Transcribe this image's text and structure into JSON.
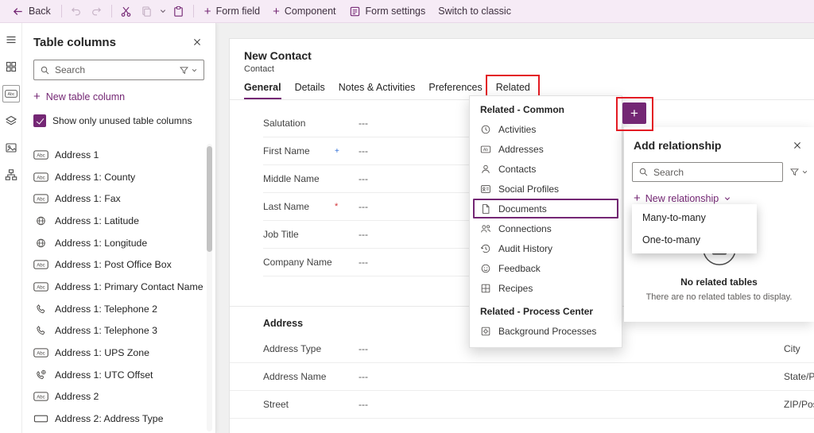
{
  "colors": {
    "accent": "#742774",
    "annotation": "#e31b23",
    "required": "#d13438",
    "recommended": "#2b6bd6"
  },
  "toolbar": {
    "back_label": "Back",
    "form_field_label": "Form field",
    "component_label": "Component",
    "form_settings_label": "Form settings",
    "switch_classic_label": "Switch to classic"
  },
  "left_panel": {
    "title": "Table columns",
    "search_placeholder": "Search",
    "new_column_label": "New table column",
    "checkbox_label": "Show only unused table columns",
    "items": [
      {
        "icon": "abc",
        "label": "Address 1"
      },
      {
        "icon": "abc",
        "label": "Address 1: County"
      },
      {
        "icon": "abc",
        "label": "Address 1: Fax"
      },
      {
        "icon": "globe",
        "label": "Address 1: Latitude"
      },
      {
        "icon": "globe",
        "label": "Address 1: Longitude"
      },
      {
        "icon": "abc",
        "label": "Address 1: Post Office Box"
      },
      {
        "icon": "abc",
        "label": "Address 1: Primary Contact Name"
      },
      {
        "icon": "phone",
        "label": "Address 1: Telephone 2"
      },
      {
        "icon": "phone",
        "label": "Address 1: Telephone 3"
      },
      {
        "icon": "abc",
        "label": "Address 1: UPS Zone"
      },
      {
        "icon": "phoneglobe",
        "label": "Address 1: UTC Offset"
      },
      {
        "icon": "abc",
        "label": "Address 2"
      },
      {
        "icon": "optionset",
        "label": "Address 2: Address Type"
      }
    ]
  },
  "form": {
    "title": "New Contact",
    "subtitle": "Contact",
    "tabs": [
      {
        "label": "General",
        "active": true
      },
      {
        "label": "Details"
      },
      {
        "label": "Notes & Activities"
      },
      {
        "label": "Preferences"
      },
      {
        "label": "Related",
        "annotated": true
      }
    ],
    "fields": [
      {
        "label": "Salutation",
        "value": "---"
      },
      {
        "label": "First Name",
        "value": "---",
        "required": "blue"
      },
      {
        "label": "Middle Name",
        "value": "---"
      },
      {
        "label": "Last Name",
        "value": "---",
        "required": "red"
      },
      {
        "label": "Job Title",
        "value": "---"
      },
      {
        "label": "Company Name",
        "value": "---"
      }
    ],
    "address_section": {
      "title": "Address",
      "fields": [
        {
          "label": "Address Type",
          "value": "---"
        },
        {
          "label": "Address Name",
          "value": "---"
        },
        {
          "label": "Street",
          "value": "---"
        }
      ]
    },
    "right_column_labels": [
      "City",
      "State/Pro",
      "ZIP/Posta"
    ]
  },
  "related_menu": {
    "sections": [
      {
        "title": "Related - Common",
        "items": [
          {
            "icon": "clock",
            "label": "Activities"
          },
          {
            "icon": "ab",
            "label": "Addresses"
          },
          {
            "icon": "person",
            "label": "Contacts"
          },
          {
            "icon": "idcard",
            "label": "Social Profiles"
          },
          {
            "icon": "page",
            "label": "Documents",
            "selected": true
          },
          {
            "icon": "people",
            "label": "Connections"
          },
          {
            "icon": "history",
            "label": "Audit History"
          },
          {
            "icon": "smiley",
            "label": "Feedback"
          },
          {
            "icon": "grid",
            "label": "Recipes"
          }
        ]
      },
      {
        "title": "Related - Process Center",
        "items": [
          {
            "icon": "process",
            "label": "Background Processes"
          }
        ]
      }
    ]
  },
  "relationship_panel": {
    "title": "Add relationship",
    "search_placeholder": "Search",
    "new_relationship_label": "New relationship",
    "menu_options": [
      "Many-to-many",
      "One-to-many"
    ],
    "empty_title": "No related tables",
    "empty_message": "There are no related tables to display."
  }
}
